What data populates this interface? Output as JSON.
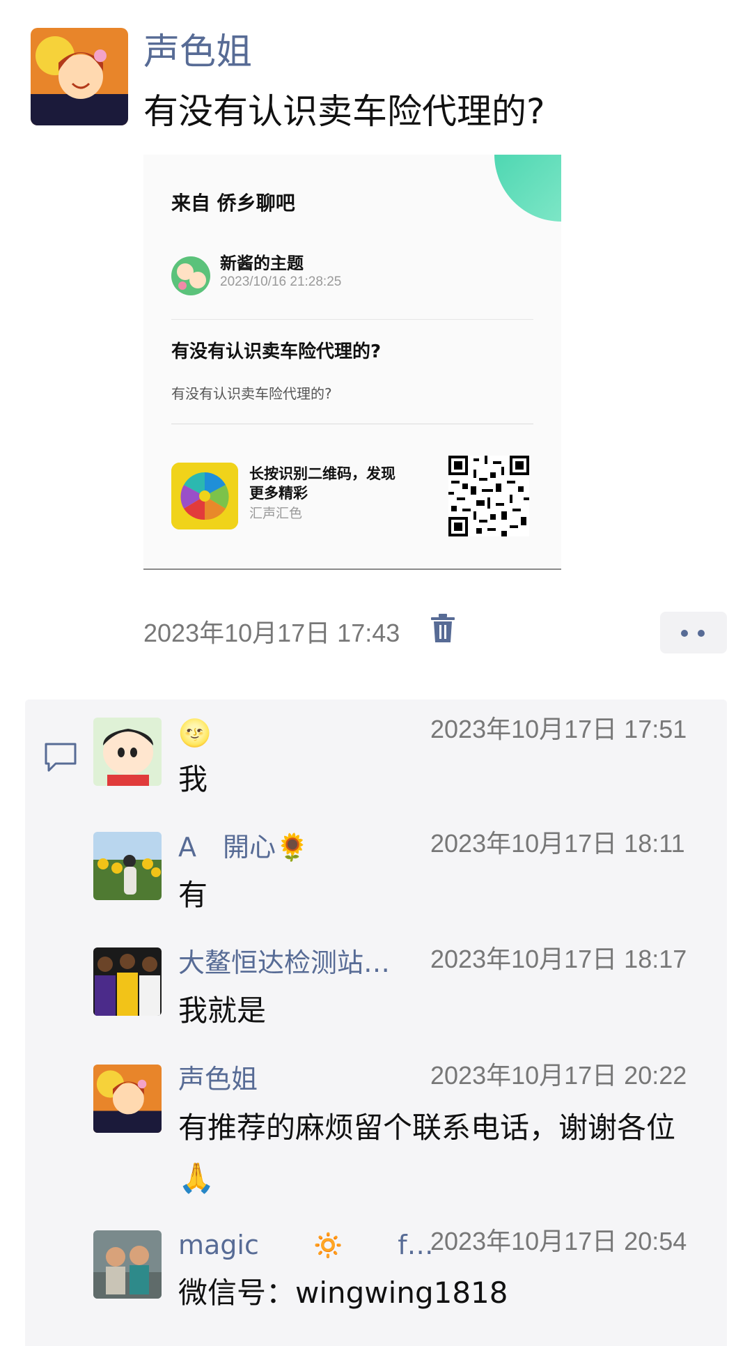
{
  "post": {
    "author": "声色姐",
    "text": "有没有认识卖车险代理的?",
    "time": "2023年10月17日 17:43"
  },
  "share_card": {
    "from": "来自 侨乡聊吧",
    "topic_author": "新酱的主题",
    "topic_time": "2023/10/16 21:28:25",
    "title": "有没有认识卖车险代理的?",
    "subtitle": "有没有认识卖车险代理的?",
    "qr_hint": "长按识别二维码，发现更多精彩",
    "app_name": "汇声汇色"
  },
  "comments": [
    {
      "name": "🌝",
      "time": "2023年10月17日 17:51",
      "text": "我"
    },
    {
      "name": "A　開心🌻",
      "time": "2023年10月17日 18:11",
      "text": "有"
    },
    {
      "name": "大鳌恒达检测站…",
      "time": "2023年10月17日 18:17",
      "text": "我就是"
    },
    {
      "name": "声色姐",
      "time": "2023年10月17日 20:22",
      "text": "有推荐的麻烦留个联系电话，谢谢各位🙏"
    },
    {
      "name": "magic　　🔅　　f…",
      "time": "2023年10月17日 20:54",
      "text": "微信号：wingwing1818"
    }
  ],
  "colors": {
    "link": "#576b95",
    "accent": "#4fd7b2",
    "app_logo_bg": "#f0d31a"
  },
  "icons": [
    "delete-icon",
    "more-icon",
    "comment-icon",
    "qr-code-icon"
  ]
}
